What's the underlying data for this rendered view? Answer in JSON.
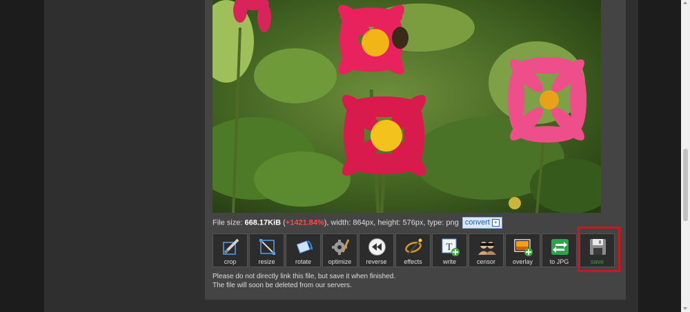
{
  "file_info": {
    "size_label": "File size: ",
    "size_value": "668.17KiB",
    "open_paren": " (",
    "size_change": "+1421.84%",
    "close_rest": "), width: 864px, height: 576px, type: png",
    "convert_label": "convert",
    "convert_plus": "+"
  },
  "tools": [
    {
      "label": "crop",
      "icon": "crop-icon"
    },
    {
      "label": "resize",
      "icon": "resize-icon"
    },
    {
      "label": "rotate",
      "icon": "rotate-icon"
    },
    {
      "label": "optimize",
      "icon": "optimize-icon"
    },
    {
      "label": "reverse",
      "icon": "reverse-icon"
    },
    {
      "label": "effects",
      "icon": "effects-icon"
    },
    {
      "label": "write",
      "icon": "write-icon"
    },
    {
      "label": "censor",
      "icon": "censor-icon"
    },
    {
      "label": "overlay",
      "icon": "overlay-icon"
    },
    {
      "label": "to JPG",
      "icon": "to-jpg-icon"
    },
    {
      "label": "save",
      "icon": "save-icon"
    }
  ],
  "note": {
    "line1": "Please do not directly link this file, but save it when finished.",
    "line2": "The file will soon be deleted from our servers."
  },
  "write_icon_letter": "T",
  "colors": {
    "highlight": "#d0141e",
    "size_change": "#ff4a4a",
    "save_label": "#3f9f3f"
  }
}
